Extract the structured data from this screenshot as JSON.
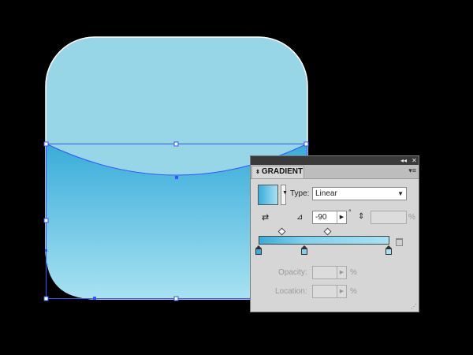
{
  "colors": {
    "background": "#000000",
    "shape_fill": "#96d6e7",
    "gradient_start": "#39acd9",
    "gradient_end": "#a8e2f2",
    "selection": "#3355ff"
  },
  "panel": {
    "title": "GRADIENT",
    "collapse_icon": "double-left-arrow-icon",
    "close_icon": "close-icon",
    "menu_icon": "panel-menu-icon",
    "type_label": "Type:",
    "type_value": "Linear",
    "angle_value": "-90",
    "degree_symbol": "°",
    "aspect_value": "",
    "aspect_unit": "%",
    "opacity_label": "Opacity:",
    "opacity_value": "",
    "opacity_unit": "%",
    "location_label": "Location:",
    "location_value": "",
    "location_unit": "%",
    "stop_colors": [
      "#39acd9",
      "#7fd2ef",
      "#a8e2f2"
    ]
  }
}
